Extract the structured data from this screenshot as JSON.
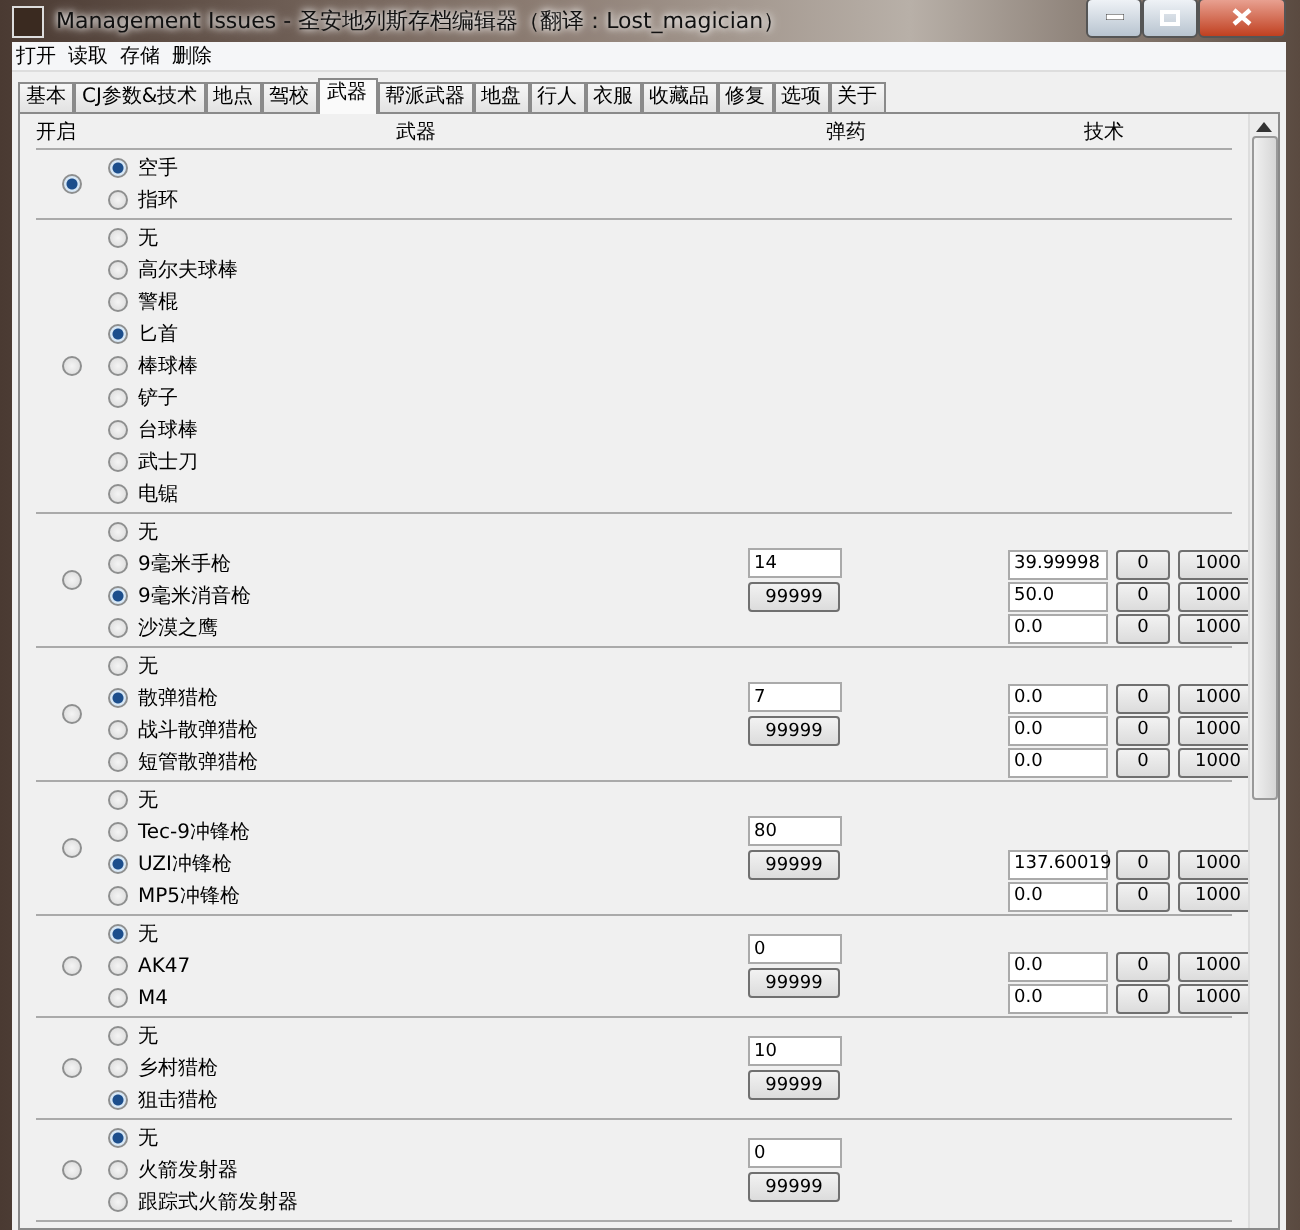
{
  "window": {
    "title": "Management Issues - 圣安地列斯存档编辑器（翻译：Lost_magician）"
  },
  "menu": [
    "打开",
    "读取",
    "存储",
    "删除"
  ],
  "tabs": [
    {
      "label": "基本",
      "selected": false
    },
    {
      "label": "CJ参数&技术",
      "selected": false
    },
    {
      "label": "地点",
      "selected": false
    },
    {
      "label": "驾校",
      "selected": false
    },
    {
      "label": "武器",
      "selected": true
    },
    {
      "label": "帮派武器",
      "selected": false
    },
    {
      "label": "地盘",
      "selected": false
    },
    {
      "label": "行人",
      "selected": false
    },
    {
      "label": "衣服",
      "selected": false
    },
    {
      "label": "收藏品",
      "selected": false
    },
    {
      "label": "修复",
      "selected": false
    },
    {
      "label": "选项",
      "selected": false
    },
    {
      "label": "关于",
      "selected": false
    }
  ],
  "columns": [
    "开启",
    "武器",
    "弹药",
    "技术"
  ],
  "groups": [
    {
      "enabled": true,
      "weapons": [
        {
          "label": "空手",
          "selected": true
        },
        {
          "label": "指环",
          "selected": false
        }
      ]
    },
    {
      "enabled": false,
      "weapons": [
        {
          "label": "无",
          "selected": false
        },
        {
          "label": "高尔夫球棒",
          "selected": false
        },
        {
          "label": "警棍",
          "selected": false
        },
        {
          "label": "匕首",
          "selected": true
        },
        {
          "label": "棒球棒",
          "selected": false
        },
        {
          "label": "铲子",
          "selected": false
        },
        {
          "label": "台球棒",
          "selected": false
        },
        {
          "label": "武士刀",
          "selected": false
        },
        {
          "label": "电锯",
          "selected": false
        }
      ]
    },
    {
      "enabled": false,
      "ammo": {
        "value": "14",
        "button": "99999"
      },
      "weapons": [
        {
          "label": "无",
          "selected": false
        },
        {
          "label": "9毫米手枪",
          "selected": false,
          "skill": {
            "value": "39.99998",
            "min": "0",
            "max": "1000"
          }
        },
        {
          "label": "9毫米消音枪",
          "selected": true,
          "skill": {
            "value": "50.0",
            "min": "0",
            "max": "1000"
          }
        },
        {
          "label": "沙漠之鹰",
          "selected": false,
          "skill": {
            "value": "0.0",
            "min": "0",
            "max": "1000"
          }
        }
      ]
    },
    {
      "enabled": false,
      "ammo": {
        "value": "7",
        "button": "99999"
      },
      "weapons": [
        {
          "label": "无",
          "selected": false
        },
        {
          "label": "散弹猎枪",
          "selected": true,
          "skill": {
            "value": "0.0",
            "min": "0",
            "max": "1000"
          }
        },
        {
          "label": "战斗散弹猎枪",
          "selected": false,
          "skill": {
            "value": "0.0",
            "min": "0",
            "max": "1000"
          }
        },
        {
          "label": "短管散弹猎枪",
          "selected": false,
          "skill": {
            "value": "0.0",
            "min": "0",
            "max": "1000"
          }
        }
      ]
    },
    {
      "enabled": false,
      "ammo": {
        "value": "80",
        "button": "99999"
      },
      "weapons": [
        {
          "label": "无",
          "selected": false
        },
        {
          "label": "Tec-9冲锋枪",
          "selected": false
        },
        {
          "label": "UZI冲锋枪",
          "selected": true,
          "skill": {
            "value": "137.60019",
            "min": "0",
            "max": "1000"
          }
        },
        {
          "label": "MP5冲锋枪",
          "selected": false,
          "skill": {
            "value": "0.0",
            "min": "0",
            "max": "1000"
          }
        }
      ]
    },
    {
      "enabled": false,
      "ammo": {
        "value": "0",
        "button": "99999"
      },
      "weapons": [
        {
          "label": "无",
          "selected": true
        },
        {
          "label": "AK47",
          "selected": false,
          "skill": {
            "value": "0.0",
            "min": "0",
            "max": "1000"
          }
        },
        {
          "label": "M4",
          "selected": false,
          "skill": {
            "value": "0.0",
            "min": "0",
            "max": "1000"
          }
        }
      ]
    },
    {
      "enabled": false,
      "ammo": {
        "value": "10",
        "button": "99999"
      },
      "weapons": [
        {
          "label": "无",
          "selected": false
        },
        {
          "label": "乡村猎枪",
          "selected": false
        },
        {
          "label": "狙击猎枪",
          "selected": true
        }
      ]
    },
    {
      "enabled": false,
      "ammo": {
        "value": "0",
        "button": "99999"
      },
      "weapons": [
        {
          "label": "无",
          "selected": true
        },
        {
          "label": "火箭发射器",
          "selected": false
        },
        {
          "label": "跟踪式火箭发射器",
          "selected": false
        }
      ]
    }
  ]
}
